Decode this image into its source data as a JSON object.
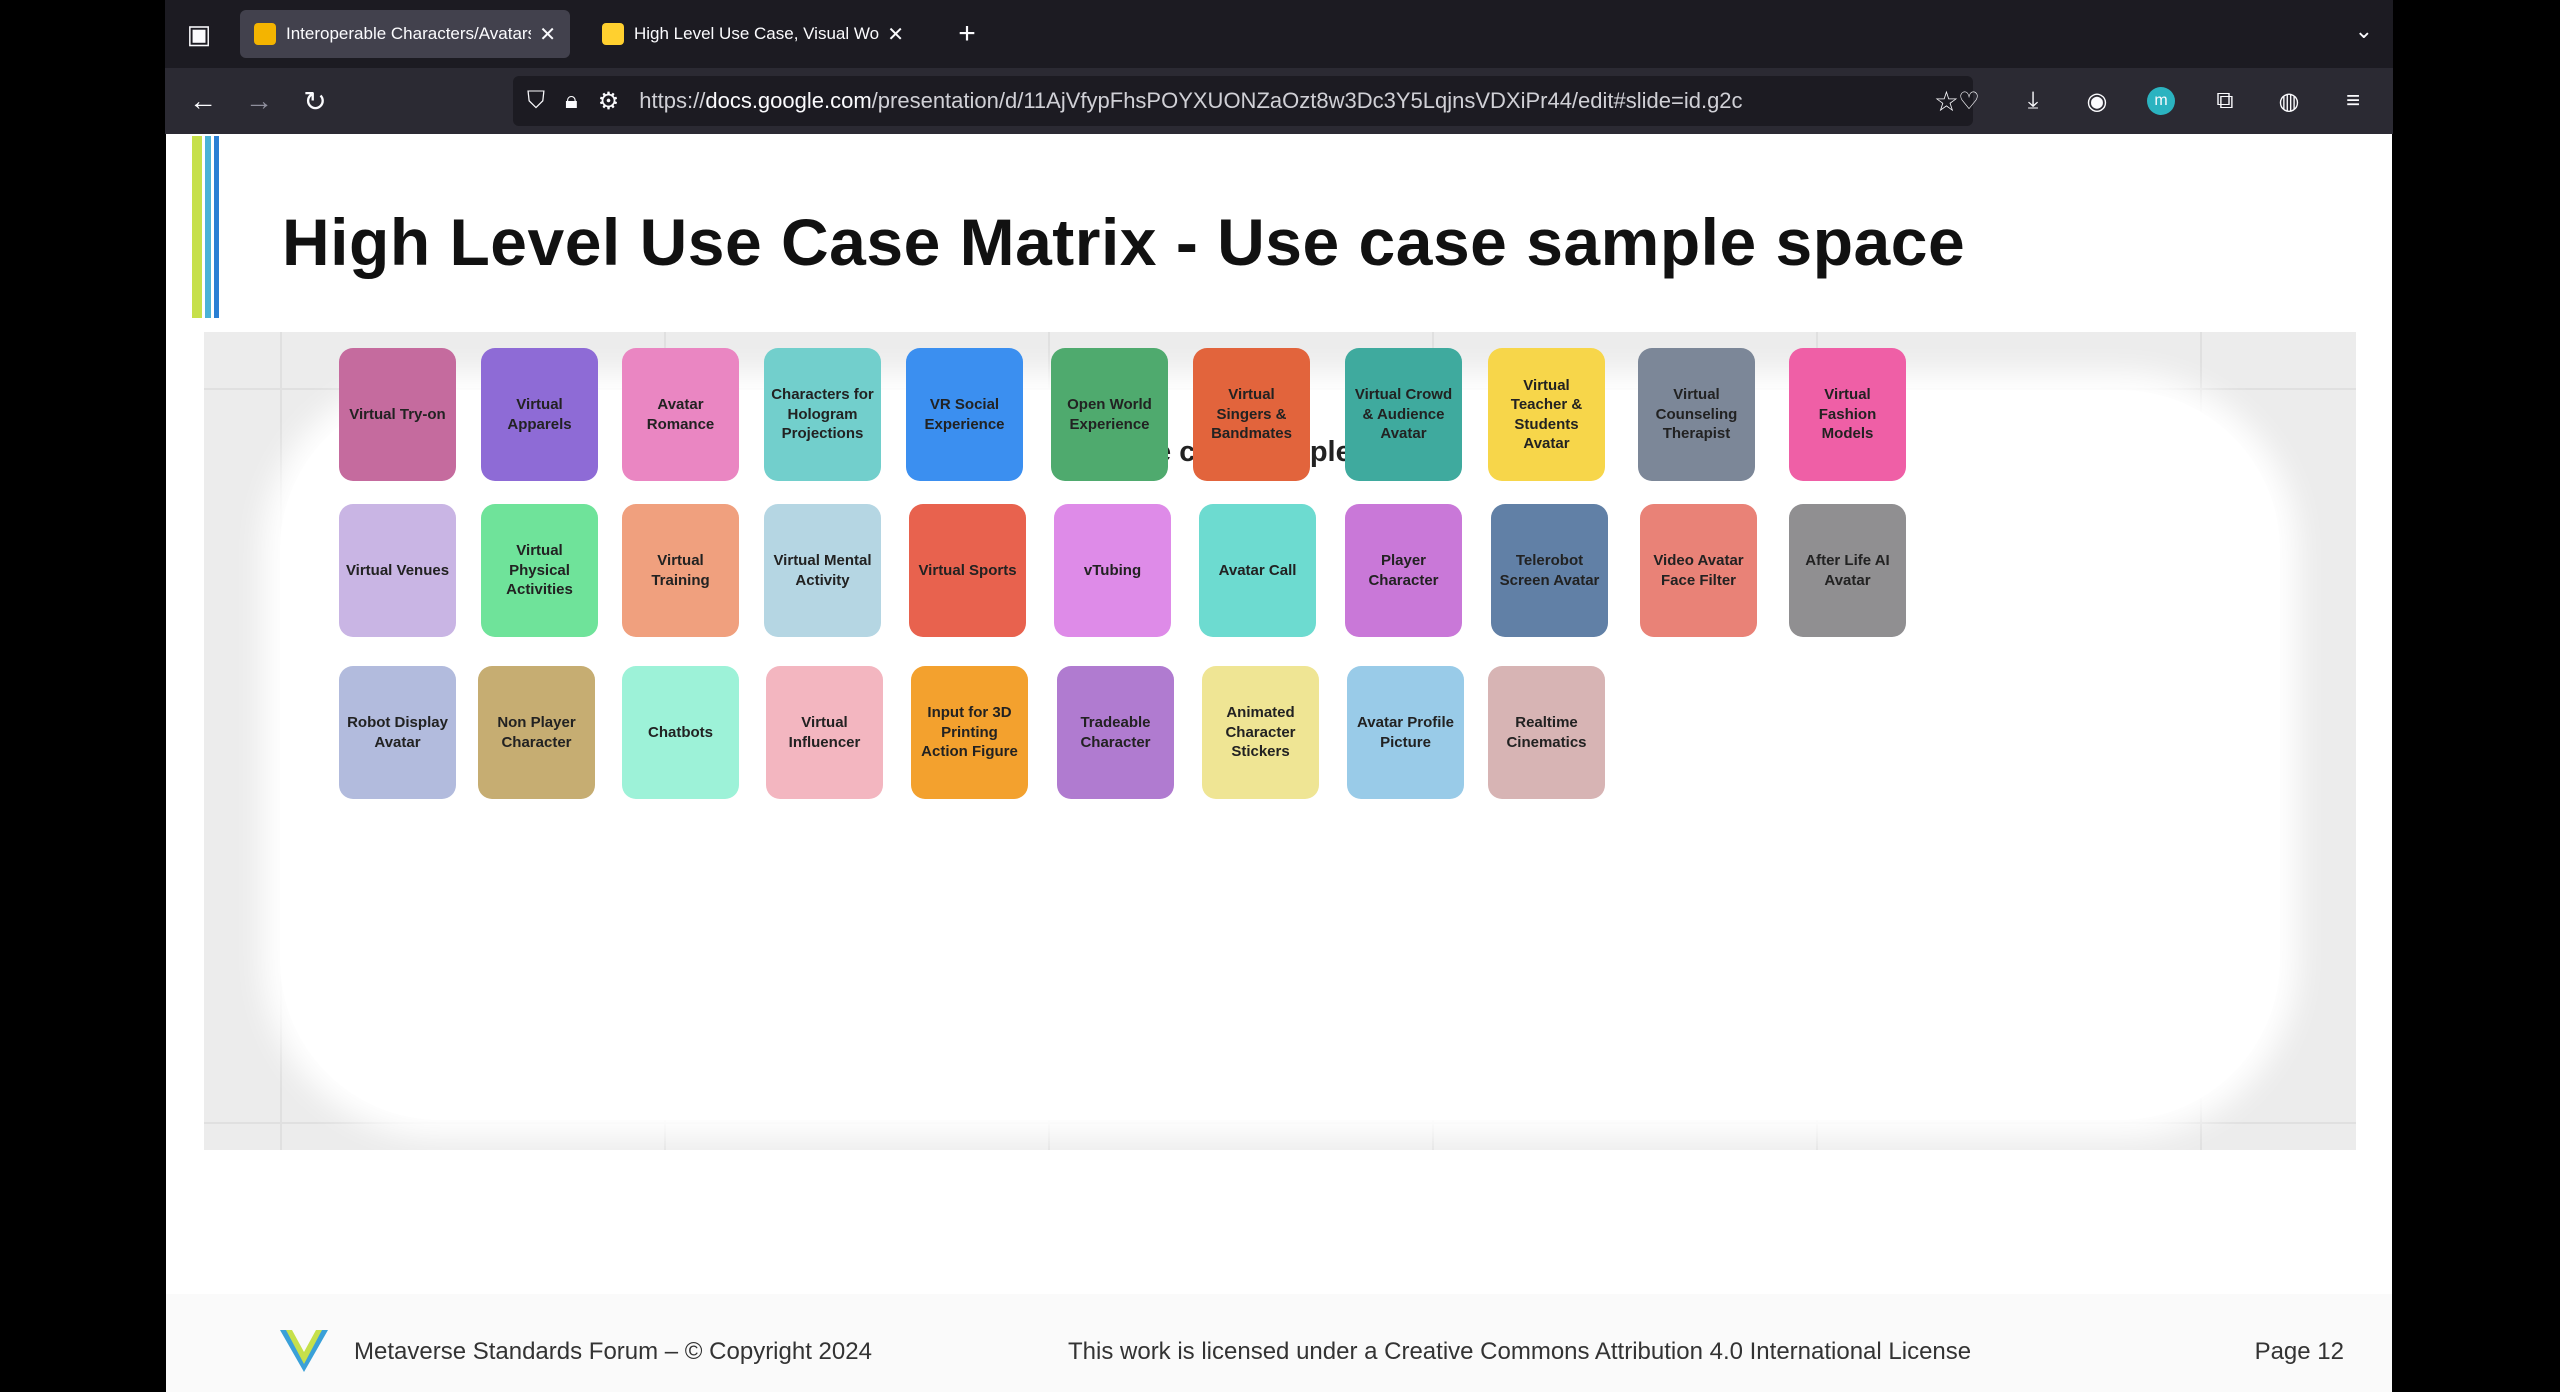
{
  "browser": {
    "tabs": [
      {
        "label": "Interoperable Characters/Avatars",
        "active": true,
        "favicon_color": "#f4b400"
      },
      {
        "label": "High Level Use Case, Visual Wo",
        "active": false,
        "favicon_color": "#ffd02f"
      }
    ],
    "new_tab_label": "+",
    "url_domain": "docs.google.com",
    "url_prefix": "https://",
    "url_suffix": "/presentation/d/11AjVfypFhsPOYXUONZaOzt8w3Dc3Y5LqjnsVDXiPr44/edit#slide=id.g2c"
  },
  "slide": {
    "title": "High Level Use Case Matrix - Use case sample space",
    "accent_colors": [
      "#c6e04a",
      "#4bb3d6",
      "#2a7fd4"
    ],
    "diagram_title": "Use case sample space",
    "cards": [
      {
        "label": "Virtual Try-on",
        "color": "#c56b9e"
      },
      {
        "label": "Virtual Apparels",
        "color": "#8e6bd6"
      },
      {
        "label": "Avatar Romance",
        "color": "#ea86c2"
      },
      {
        "label": "Characters for Hologram Projections",
        "color": "#72cfcc"
      },
      {
        "label": "VR Social Experience",
        "color": "#3b8ff0"
      },
      {
        "label": "Open World Experience",
        "color": "#4faa6e"
      },
      {
        "label": "Virtual Singers & Bandmates",
        "color": "#e2643c"
      },
      {
        "label": "Virtual Crowd & Audience Avatar",
        "color": "#3faa9e"
      },
      {
        "label": "Virtual Teacher & Students Avatar",
        "color": "#f7d64a"
      },
      {
        "label": "Virtual Counseling Therapist",
        "color": "#7c8798"
      },
      {
        "label": "Virtual Fashion Models",
        "color": "#ef5fa6"
      },
      {
        "label": "Virtual Venues",
        "color": "#c9b5e4"
      },
      {
        "label": "Virtual Physical Activities",
        "color": "#6fe39a"
      },
      {
        "label": "Virtual Training",
        "color": "#f0a07e"
      },
      {
        "label": "Virtual Mental Activity",
        "color": "#b5d6e3"
      },
      {
        "label": "Virtual Sports",
        "color": "#e8624e"
      },
      {
        "label": "vTubing",
        "color": "#de8be8"
      },
      {
        "label": "Avatar Call",
        "color": "#6ddbd0"
      },
      {
        "label": "Player Character",
        "color": "#c978d8"
      },
      {
        "label": "Telerobot Screen Avatar",
        "color": "#6180a6"
      },
      {
        "label": "Video Avatar Face Filter",
        "color": "#e98277"
      },
      {
        "label": "After Life AI Avatar",
        "color": "#908f91"
      },
      {
        "label": "Robot Display Avatar",
        "color": "#b2bbdd"
      },
      {
        "label": "Non Player Character",
        "color": "#c6ad72"
      },
      {
        "label": "Chatbots",
        "color": "#9df2d8"
      },
      {
        "label": "Virtual Influencer",
        "color": "#f3b6c0"
      },
      {
        "label": "Input for 3D Printing Action Figure",
        "color": "#f3a12e"
      },
      {
        "label": "Tradeable Character",
        "color": "#b07bd0"
      },
      {
        "label": "Animated Character Stickers",
        "color": "#efe594"
      },
      {
        "label": "Avatar Profile Picture",
        "color": "#99cbe8"
      },
      {
        "label": "Realtime Cinematics",
        "color": "#d7b4b4"
      }
    ],
    "footer": {
      "left": "Metaverse Standards Forum – © Copyright 2024",
      "middle": "This work is licensed under a Creative Commons Attribution 4.0 International License",
      "page": "Page 12"
    }
  }
}
